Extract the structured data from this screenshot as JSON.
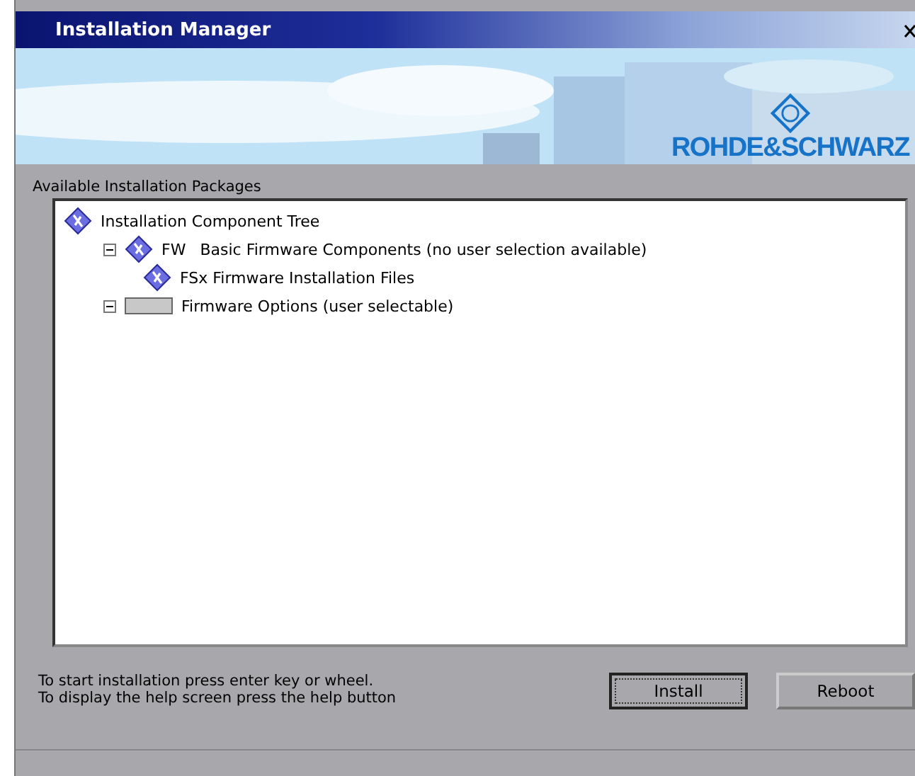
{
  "window": {
    "title": "Installation Manager"
  },
  "banner": {
    "brand": "ROHDE&SCHWARZ"
  },
  "packages": {
    "label": "Available Installation Packages",
    "tree": [
      {
        "kind": "package",
        "text": "Installation Component Tree",
        "children": [
          {
            "kind": "package",
            "tag": "FW",
            "text": "Basic Firmware Components (no user selection available)",
            "expanded": true,
            "children": [
              {
                "kind": "package",
                "text": "FSx Firmware Installation Files"
              }
            ]
          },
          {
            "kind": "options",
            "text": "Firmware Options (user selectable)",
            "expanded": true
          }
        ]
      }
    ]
  },
  "hints": [
    "To start installation press enter key or wheel.",
    "To display the help screen press the help button"
  ],
  "buttons": [
    {
      "label": "Install",
      "selected": true
    },
    {
      "label": "Reboot",
      "selected": false
    }
  ]
}
